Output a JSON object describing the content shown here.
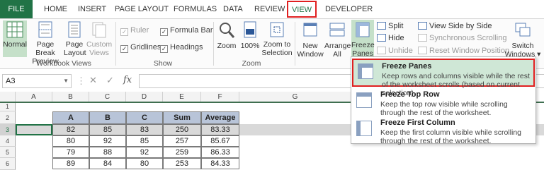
{
  "tabs": {
    "file": "FILE",
    "home": "HOME",
    "insert": "INSERT",
    "page_layout": "PAGE LAYOUT",
    "formulas": "FORMULAS",
    "data": "DATA",
    "review": "REVIEW",
    "view": "VIEW",
    "developer": "DEVELOPER"
  },
  "ribbon": {
    "workbook_views": {
      "label": "Workbook Views",
      "normal": "Normal",
      "page_break_1": "Page Break",
      "page_break_2": "Preview",
      "page_layout_1": "Page",
      "page_layout_2": "Layout",
      "custom_1": "Custom",
      "custom_2": "Views"
    },
    "show": {
      "label": "Show",
      "ruler": "Ruler",
      "formula_bar": "Formula Bar",
      "gridlines": "Gridlines",
      "headings": "Headings"
    },
    "zoom": {
      "label": "Zoom",
      "zoom": "Zoom",
      "zoom100": "100%",
      "zoom_sel_1": "Zoom to",
      "zoom_sel_2": "Selection"
    },
    "window": {
      "new_1": "New",
      "new_2": "Window",
      "arrange_1": "Arrange",
      "arrange_2": "All",
      "freeze_1": "Freeze",
      "freeze_2": "Panes ▾",
      "split": "Split",
      "hide": "Hide",
      "unhide": "Unhide",
      "side_by_side": "View Side by Side",
      "sync_scroll": "Synchronous Scrolling",
      "reset_pos": "Reset Window Position",
      "switch_1": "Switch",
      "switch_2": "Windows ▾"
    }
  },
  "formula_bar": {
    "name_box": "A3",
    "fx": "fx",
    "value": ""
  },
  "sheet": {
    "columns": [
      "A",
      "B",
      "C",
      "D",
      "E",
      "F",
      "G"
    ],
    "rows": [
      "1",
      "2",
      "3",
      "4",
      "5",
      "6"
    ],
    "table_header": [
      "A",
      "B",
      "C",
      "Sum",
      "Average"
    ],
    "table_rows": [
      [
        "82",
        "85",
        "83",
        "250",
        "83.33"
      ],
      [
        "80",
        "92",
        "85",
        "257",
        "85.67"
      ],
      [
        "79",
        "88",
        "92",
        "259",
        "86.33"
      ],
      [
        "89",
        "84",
        "80",
        "253",
        "84.33"
      ]
    ]
  },
  "freeze_menu": {
    "items": [
      {
        "title": "Freeze Panes",
        "desc": "Keep rows and columns visible while the rest of the worksheet scrolls (based on current selection)."
      },
      {
        "title": "Freeze Top Row",
        "desc": "Keep the top row visible while scrolling through the rest of the worksheet."
      },
      {
        "title": "Freeze First Column",
        "desc": "Keep the first column visible while scrolling through the rest of the worksheet."
      }
    ]
  },
  "colors": {
    "excel_green": "#217346",
    "highlight_red": "#e02020",
    "table_header_bg": "#b8c4d8",
    "menu_highlight": "#cfe7d6"
  }
}
